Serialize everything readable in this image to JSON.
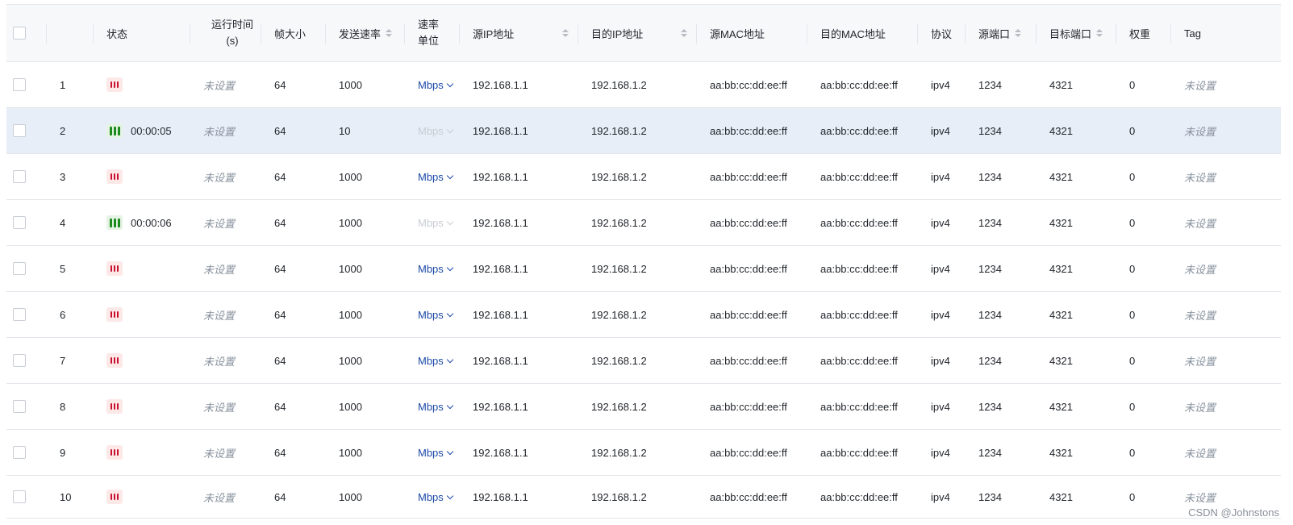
{
  "header": {
    "status": "状态",
    "runtime_line1": "运行时间",
    "runtime_line2": "(s)",
    "frame_size": "帧大小",
    "send_rate": "发送速率",
    "rate_unit_line1": "速率",
    "rate_unit_line2": "单位",
    "src_ip": "源IP地址",
    "dst_ip": "目的IP地址",
    "src_mac": "源MAC地址",
    "dst_mac": "目的MAC地址",
    "protocol": "协议",
    "src_port": "源端口",
    "dst_port": "目标端口",
    "weight": "权重",
    "tag": "Tag"
  },
  "rows": [
    {
      "index": "1",
      "status": "stopped",
      "time": "",
      "runtime": "未设置",
      "frame": "64",
      "rate": "1000",
      "unit": "Mbps",
      "unit_disabled": false,
      "src_ip": "192.168.1.1",
      "dst_ip": "192.168.1.2",
      "src_mac": "aa:bb:cc:dd:ee:ff",
      "dst_mac": "aa:bb:cc:dd:ee:ff",
      "protocol": "ipv4",
      "src_port": "1234",
      "dst_port": "4321",
      "weight": "0",
      "tag": "未设置"
    },
    {
      "index": "2",
      "status": "running",
      "time": "00:00:05",
      "runtime": "未设置",
      "frame": "64",
      "rate": "10",
      "unit": "Mbps",
      "unit_disabled": true,
      "src_ip": "192.168.1.1",
      "dst_ip": "192.168.1.2",
      "src_mac": "aa:bb:cc:dd:ee:ff",
      "dst_mac": "aa:bb:cc:dd:ee:ff",
      "protocol": "ipv4",
      "src_port": "1234",
      "dst_port": "4321",
      "weight": "0",
      "tag": "未设置"
    },
    {
      "index": "3",
      "status": "stopped",
      "time": "",
      "runtime": "未设置",
      "frame": "64",
      "rate": "1000",
      "unit": "Mbps",
      "unit_disabled": false,
      "src_ip": "192.168.1.1",
      "dst_ip": "192.168.1.2",
      "src_mac": "aa:bb:cc:dd:ee:ff",
      "dst_mac": "aa:bb:cc:dd:ee:ff",
      "protocol": "ipv4",
      "src_port": "1234",
      "dst_port": "4321",
      "weight": "0",
      "tag": "未设置"
    },
    {
      "index": "4",
      "status": "running",
      "time": "00:00:06",
      "runtime": "未设置",
      "frame": "64",
      "rate": "1000",
      "unit": "Mbps",
      "unit_disabled": true,
      "src_ip": "192.168.1.1",
      "dst_ip": "192.168.1.2",
      "src_mac": "aa:bb:cc:dd:ee:ff",
      "dst_mac": "aa:bb:cc:dd:ee:ff",
      "protocol": "ipv4",
      "src_port": "1234",
      "dst_port": "4321",
      "weight": "0",
      "tag": "未设置"
    },
    {
      "index": "5",
      "status": "stopped",
      "time": "",
      "runtime": "未设置",
      "frame": "64",
      "rate": "1000",
      "unit": "Mbps",
      "unit_disabled": false,
      "src_ip": "192.168.1.1",
      "dst_ip": "192.168.1.2",
      "src_mac": "aa:bb:cc:dd:ee:ff",
      "dst_mac": "aa:bb:cc:dd:ee:ff",
      "protocol": "ipv4",
      "src_port": "1234",
      "dst_port": "4321",
      "weight": "0",
      "tag": "未设置"
    },
    {
      "index": "6",
      "status": "stopped",
      "time": "",
      "runtime": "未设置",
      "frame": "64",
      "rate": "1000",
      "unit": "Mbps",
      "unit_disabled": false,
      "src_ip": "192.168.1.1",
      "dst_ip": "192.168.1.2",
      "src_mac": "aa:bb:cc:dd:ee:ff",
      "dst_mac": "aa:bb:cc:dd:ee:ff",
      "protocol": "ipv4",
      "src_port": "1234",
      "dst_port": "4321",
      "weight": "0",
      "tag": "未设置"
    },
    {
      "index": "7",
      "status": "stopped",
      "time": "",
      "runtime": "未设置",
      "frame": "64",
      "rate": "1000",
      "unit": "Mbps",
      "unit_disabled": false,
      "src_ip": "192.168.1.1",
      "dst_ip": "192.168.1.2",
      "src_mac": "aa:bb:cc:dd:ee:ff",
      "dst_mac": "aa:bb:cc:dd:ee:ff",
      "protocol": "ipv4",
      "src_port": "1234",
      "dst_port": "4321",
      "weight": "0",
      "tag": "未设置"
    },
    {
      "index": "8",
      "status": "stopped",
      "time": "",
      "runtime": "未设置",
      "frame": "64",
      "rate": "1000",
      "unit": "Mbps",
      "unit_disabled": false,
      "src_ip": "192.168.1.1",
      "dst_ip": "192.168.1.2",
      "src_mac": "aa:bb:cc:dd:ee:ff",
      "dst_mac": "aa:bb:cc:dd:ee:ff",
      "protocol": "ipv4",
      "src_port": "1234",
      "dst_port": "4321",
      "weight": "0",
      "tag": "未设置"
    },
    {
      "index": "9",
      "status": "stopped",
      "time": "",
      "runtime": "未设置",
      "frame": "64",
      "rate": "1000",
      "unit": "Mbps",
      "unit_disabled": false,
      "src_ip": "192.168.1.1",
      "dst_ip": "192.168.1.2",
      "src_mac": "aa:bb:cc:dd:ee:ff",
      "dst_mac": "aa:bb:cc:dd:ee:ff",
      "protocol": "ipv4",
      "src_port": "1234",
      "dst_port": "4321",
      "weight": "0",
      "tag": "未设置"
    },
    {
      "index": "10",
      "status": "stopped",
      "time": "",
      "runtime": "未设置",
      "frame": "64",
      "rate": "1000",
      "unit": "Mbps",
      "unit_disabled": false,
      "src_ip": "192.168.1.1",
      "dst_ip": "192.168.1.2",
      "src_mac": "aa:bb:cc:dd:ee:ff",
      "dst_mac": "aa:bb:cc:dd:ee:ff",
      "protocol": "ipv4",
      "src_port": "1234",
      "dst_port": "4321",
      "weight": "0",
      "tag": "未设置"
    }
  ],
  "selected_row": 2,
  "colors": {
    "stopped": "#c8102e",
    "running": "#1d8a1d",
    "unit_active": "#1d4aa8",
    "selected_row_bg": "#e8eef8"
  },
  "watermark": "CSDN @Johnstons"
}
